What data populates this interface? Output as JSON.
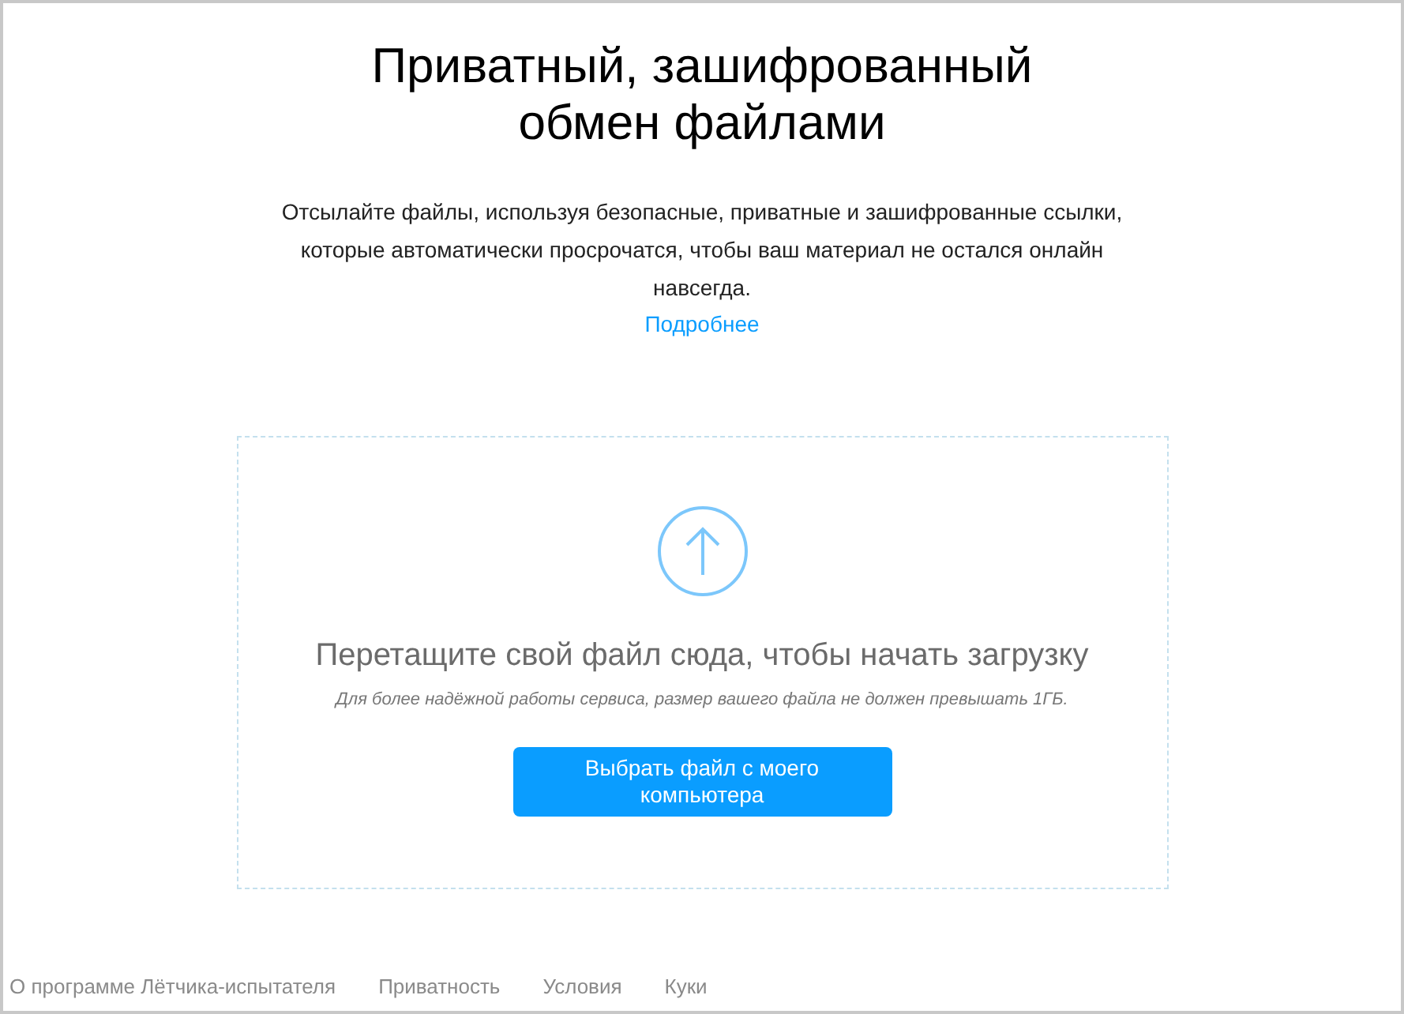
{
  "title": "Приватный, зашифрованный обмен файлами",
  "description": "Отсылайте файлы, используя безопасные, приватные и зашифрованные ссылки, которые автоматически просрочатся, чтобы ваш материал не остался онлайн навсегда.",
  "more_link": "Подробнее",
  "dropzone": {
    "heading": "Перетащите свой файл сюда, чтобы начать загрузку",
    "note": "Для более надёжной работы сервиса, размер вашего файла не должен превышать 1ГБ.",
    "button": "Выбрать файл с моего компьютера"
  },
  "footer_links": [
    "О программе Лётчика-испытателя",
    "Приватность",
    "Условия",
    "Куки"
  ]
}
